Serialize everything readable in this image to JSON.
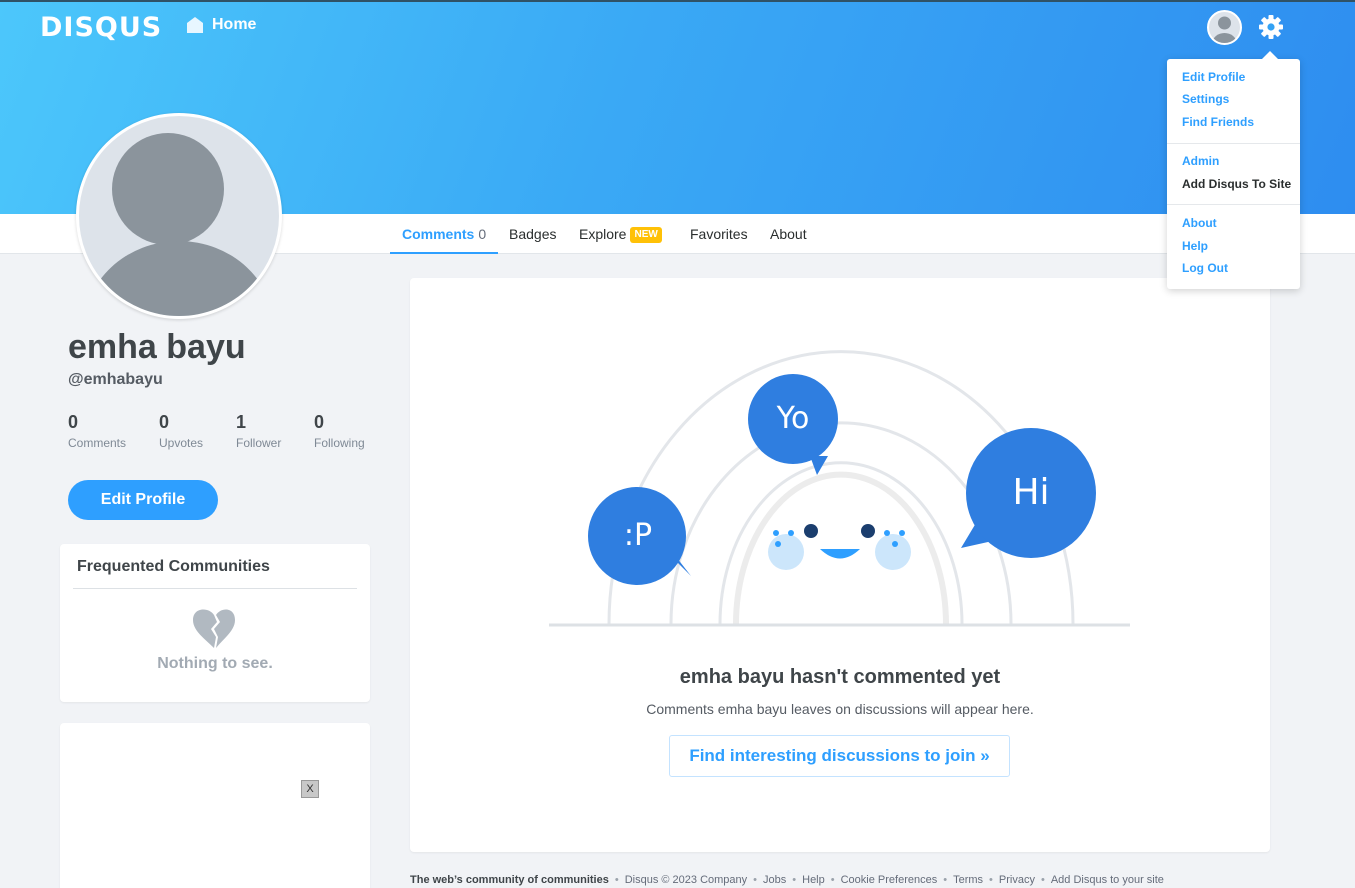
{
  "header": {
    "logo": "DISQUS",
    "home_label": "Home"
  },
  "tabs": [
    {
      "label": "Comments",
      "count": "0"
    },
    {
      "label": "Badges"
    },
    {
      "label": "Explore",
      "badge": "NEW"
    },
    {
      "label": "Favorites"
    },
    {
      "label": "About"
    }
  ],
  "profile": {
    "name": "emha bayu",
    "handle": "@emhabayu",
    "stats": [
      {
        "num": "0",
        "label": "Comments"
      },
      {
        "num": "0",
        "label": "Upvotes"
      },
      {
        "num": "1",
        "label": "Follower"
      },
      {
        "num": "0",
        "label": "Following"
      }
    ],
    "edit_button": "Edit Profile"
  },
  "communities": {
    "title": "Frequented Communities",
    "empty_text": "Nothing to see."
  },
  "ad": {
    "close_label": "X"
  },
  "empty_state": {
    "bubbles": [
      ":P",
      "Yo",
      "Hi"
    ],
    "title": "emha bayu hasn't commented yet",
    "subtitle": "Comments emha bayu leaves on discussions will appear here.",
    "button": "Find interesting discussions to join »"
  },
  "footer": {
    "tagline": "The web’s community of communities",
    "links": [
      "Disqus © 2023 Company",
      "Jobs",
      "Help",
      "Cookie Preferences",
      "Terms",
      "Privacy",
      "Add Disqus to your site"
    ]
  },
  "dropdown": {
    "items": [
      "Edit Profile",
      "Settings",
      "Find Friends",
      "Admin",
      "Add Disqus To Site",
      "About",
      "Help",
      "Log Out"
    ]
  },
  "colors": {
    "accent": "#2e9fff",
    "banner_start": "#4cc7fb",
    "banner_end": "#2e8df0",
    "bubble": "#2f7ee0",
    "badge": "#ffc107"
  }
}
